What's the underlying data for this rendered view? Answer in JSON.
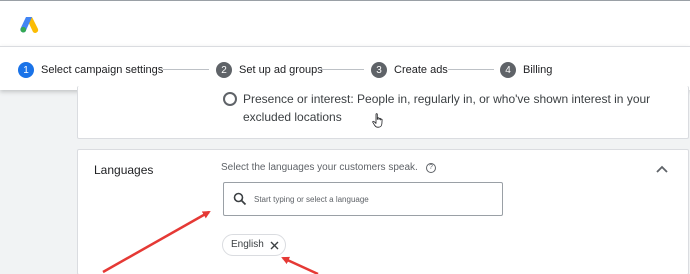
{
  "header": {
    "logo_icon": "google-ads-logo"
  },
  "stepper": {
    "steps": [
      {
        "number": "1",
        "label": "Select campaign settings",
        "active": true
      },
      {
        "number": "2",
        "label": "Set up ad groups",
        "active": false
      },
      {
        "number": "3",
        "label": "Create ads",
        "active": false
      },
      {
        "number": "4",
        "label": "Billing",
        "active": false
      }
    ]
  },
  "location_option": {
    "label": "Presence or interest: People in, regularly in, or who've shown interest in your excluded locations",
    "selected": false
  },
  "languages": {
    "title": "Languages",
    "description": "Select the languages your customers speak.",
    "search_placeholder": "Start typing or select a language",
    "selected_chips": [
      "English"
    ]
  },
  "colors": {
    "accent": "#1a73e8",
    "arrow": "#e53935",
    "background": "#f1f3f4"
  }
}
